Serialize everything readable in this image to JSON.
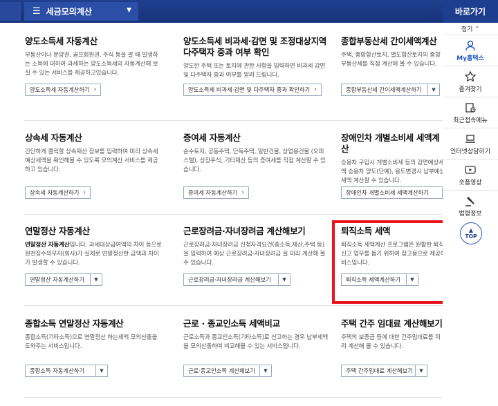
{
  "topbar": {
    "menu_label": "세금모의계산"
  },
  "sidebar": {
    "title": "바로가기",
    "fold_label": "접기",
    "items": [
      {
        "label": "My홈택스"
      },
      {
        "label": "즐겨찾기"
      },
      {
        "label": "최근접속메뉴"
      },
      {
        "label": "인터넷상담하기"
      },
      {
        "label": "숏폼영상"
      },
      {
        "label": "법령정보"
      }
    ],
    "top_label": "TOP"
  },
  "cards": [
    {
      "title": "양도소득세 자동계산",
      "desc": "부동산이나 분양권, 골프회원권, 주식 등을 팔 때 발생하는 소득에 대하여 과세하는 양도소득세의 자동계산해 보실 수 있는 서비스를 제공하고있습니다.",
      "button": "양도소득세 자동계산하기"
    },
    {
      "title": "양도소득세 비과세·감면 및 조정대상지역 다주택자 중과 여부 확인",
      "desc": "양도한 주택 또는 토지에 관한 사항을 입력하면 비과세 감면 및 다주택자 중과 여부를 알려 드립니다.",
      "button": "양도소득세 비과세·감면 및 다주택자 중과 확인하기"
    },
    {
      "title": "종합부동산세 간이세액계산",
      "desc": "주택, 종합합산토지, 별도합산토지의 종합부동산세를 직접 계산해 볼 수 있습니다.",
      "button": "종합부동산세 간이세액계산하기"
    },
    {
      "title": "상속세 자동계산",
      "desc": "간단하게 클릭할 상속재산 정보를 입력하여 미리 상속세 예상세액을 확인해볼 수 있도록 모의계산 서비스를 제공하고 있습니다.",
      "button": "상속세 자동계산하기"
    },
    {
      "title": "증여세 자동계산",
      "desc": "순수토지, 공동주택, 단독주택, 일반건물, 상업용건물 (오피스텔), 상장주식, 기타재산 등의 증여세를 직접 계산할 수 있습니다.",
      "button": "증여세 자동계산하기"
    },
    {
      "title": "장애인차 개별소비세 세액계산",
      "desc": "승용차 구입시 개별소비세 등의 감면예상세액 승용차 양도(단예), 용도변경시 납부예상 세액 계산할 수 있습니다.",
      "button": "장애인차 개별소비세 세액계산하기"
    },
    {
      "title": "연말정산 자동계산",
      "desc_bold": "연말정산 자동계산",
      "desc": "입니다. 과세대상급여액의 차이 등으로 원천징수의무자(회사)가 실제로 연말정산한 금액과 차이가 발생할 수 있습니다.",
      "button": "연말정산 자동계산하기"
    },
    {
      "title": "근로장려금·자녀장려금 계산해보기",
      "desc": "근로장려금·자녀장려금 신청자격요건(총소득,재산,주택 등) 을 입력하여 예상 근로장려금·자녀장려금 을 미리 계산해 볼 수 있습니다.",
      "button": "근로장려금·자녀장려금 계산해보기"
    },
    {
      "title": "퇴직소득 세액",
      "desc": "퇴직소득 세액계산 프로그램은 원활한 퇴직소득세 신고 업무를 돕기 위하여 참고용으로 제공하는 서비스입니다.",
      "button": "퇴직소득 세액계산하기"
    },
    {
      "title": "종합소득 연말정산 자동계산",
      "desc": "종합소득(기타소득)으로 연말정산 하는세액 모의산출을 도와주는 서비스입니다.",
      "button": "종합소득 자동계산하기"
    },
    {
      "title": "근로 · 종교인소득 세액비교",
      "desc": "근로소득과 종교인소득(기타소득)로 신고하는 경우 납부세액을 모의산출하여 비교해볼 수 있는 서비스입니다.",
      "button": "근로·종교인소득 계산해보기"
    },
    {
      "title": "주택 간주 임대료 계산해보기",
      "desc": "주택의 보증금 등에 대한 간주임대료를 미리 계산해 볼 수 있습니다.",
      "button": "주택 간주임대료 계산해보기"
    }
  ]
}
